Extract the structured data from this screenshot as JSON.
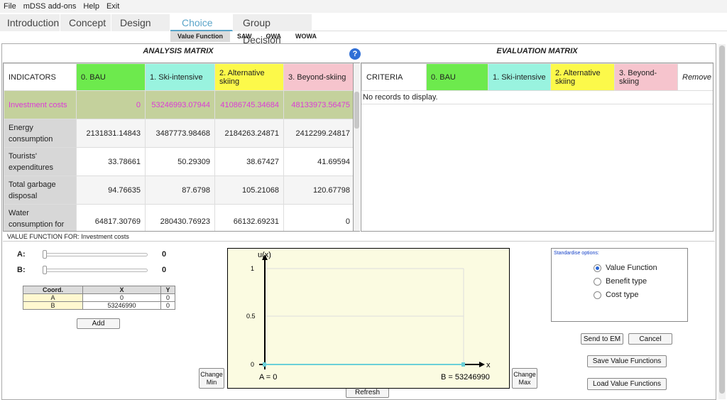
{
  "menu": [
    "File",
    "mDSS add-ons",
    "Help",
    "Exit"
  ],
  "tabs": [
    "Introduction",
    "Concept",
    "Design",
    "Choice",
    "Group Decision"
  ],
  "subtabs": [
    "Value Function",
    "SAW",
    "OWA",
    "WOWA"
  ],
  "analysis": {
    "title": "ANALYSIS MATRIX",
    "headers": [
      "INDICATORS",
      "0. BAU",
      "1. Ski-intensive",
      "2. Alternative skiing",
      "3. Beyond-skiing"
    ],
    "rows": [
      {
        "label": "Investment costs",
        "values": [
          "0",
          "53246993.07944",
          "41086745.34684",
          "48133973.56475"
        ]
      },
      {
        "label": "Energy consumption",
        "values": [
          "2131831.14843",
          "3487773.98468",
          "2184263.24871",
          "2412299.24817"
        ]
      },
      {
        "label": "Tourists' expenditures",
        "values": [
          "33.78661",
          "50.29309",
          "38.67427",
          "41.69594"
        ]
      },
      {
        "label": "Total garbage disposal",
        "values": [
          "94.76635",
          "87.6798",
          "105.21068",
          "120.67798"
        ]
      },
      {
        "label": "Water consumption for",
        "values": [
          "64817.30769",
          "280430.76923",
          "66132.69231",
          "0"
        ]
      }
    ]
  },
  "evaluation": {
    "title": "EVALUATION MATRIX",
    "headers": [
      "CRITERIA",
      "0. BAU",
      "1. Ski-intensive",
      "2. Alternative skiing",
      "3. Beyond-skiing",
      "Remove"
    ],
    "empty": "No records to display."
  },
  "value_function": {
    "title": "VALUE FUNCTION FOR: Investment costs",
    "slider_a_label": "A:",
    "slider_a_value": "0",
    "slider_b_label": "B:",
    "slider_b_value": "0",
    "coord_headers": [
      "Coord.",
      "X",
      "Y"
    ],
    "coords": [
      [
        "A",
        "0",
        "0"
      ],
      [
        "B",
        "53246990",
        "0"
      ]
    ],
    "add_label": "Add",
    "change_min": "Change Min",
    "change_max": "Change Max",
    "refresh": "Refresh",
    "chart": {
      "y_axis_label": "u(x)",
      "x_axis_label": "x",
      "y_ticks": [
        "0",
        "0.5",
        "1"
      ],
      "a_label": "A = 0",
      "b_label": "B = 53246990"
    },
    "options_title": "Standardise options:",
    "options": [
      "Value Function",
      "Benefit type",
      "Cost type"
    ],
    "selected_option": 0,
    "send_to_em": "Send to EM",
    "cancel": "Cancel",
    "save_vf": "Save Value Functions",
    "load_vf": "Load Value Functions"
  },
  "help_icon": "question-icon"
}
